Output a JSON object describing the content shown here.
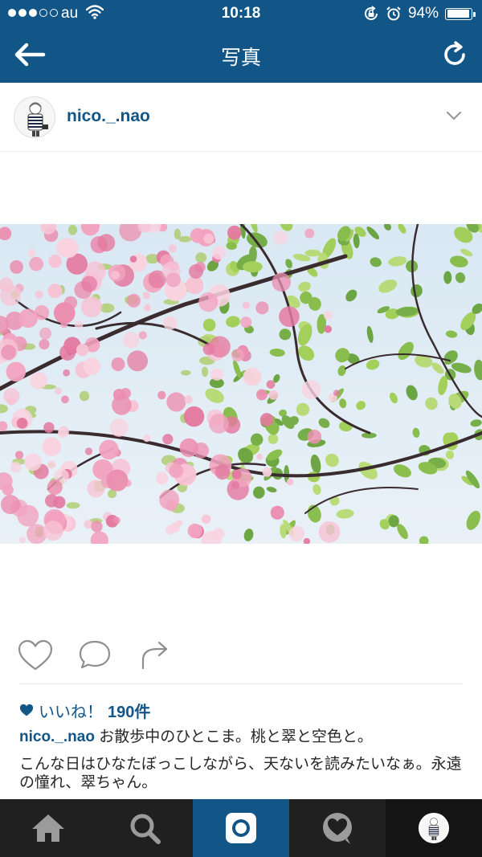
{
  "status_bar": {
    "carrier": "au",
    "time": "10:18",
    "battery": "94%",
    "battery_level": 0.94
  },
  "nav": {
    "title": "写真"
  },
  "post": {
    "username": "nico._.nao",
    "likes_label": "いいね！",
    "likes_count": "190件",
    "caption_user": "nico._.nao",
    "caption_text": " お散歩中のひとこま。桃と翠と空色と。",
    "caption_text2": "こんな日はひなたぼっこしながら、天ないを読みたいなぁ。永遠の憧れ、翠ちゃん。"
  },
  "colors": {
    "brand": "#125688",
    "tabbar": "#202020",
    "sky": "#d4e6f2"
  },
  "icons": {
    "back": "arrow-left-icon",
    "refresh": "refresh-icon",
    "more": "chevron-down-icon",
    "like": "heart-outline-icon",
    "comment": "comment-bubble-icon",
    "share": "share-arrow-icon",
    "tabs": [
      "home-icon",
      "search-icon",
      "camera-icon",
      "activity-heart-icon",
      "profile-avatar"
    ]
  }
}
